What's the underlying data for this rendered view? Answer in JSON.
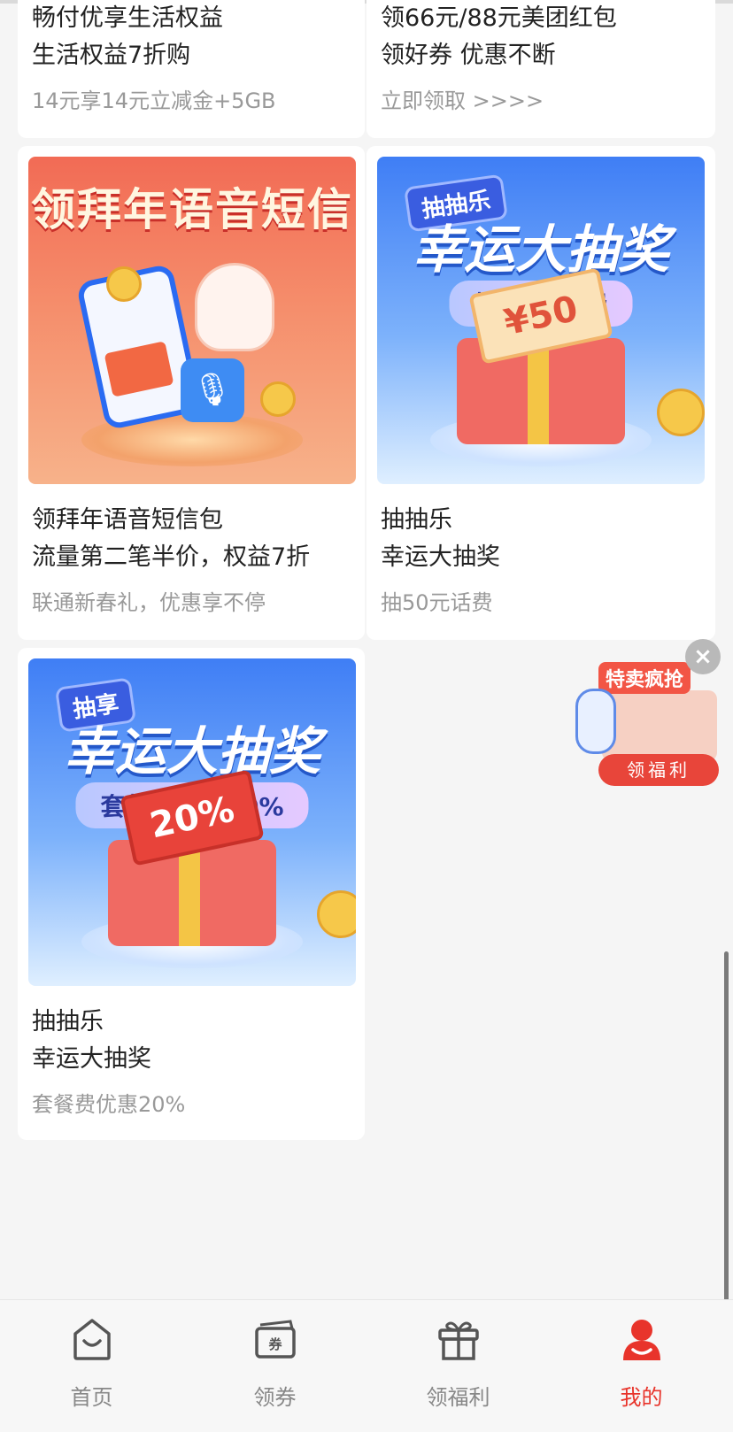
{
  "cards": [
    {
      "title1": "畅付优享生活权益",
      "title2": "生活权益7折购",
      "sub": "14元享14元立减金+5GB"
    },
    {
      "title1": "领66元/88元美团红包",
      "title2": "领好券 优惠不断",
      "sub": "立即领取 >>>>"
    },
    {
      "title1": "领拜年语音短信包",
      "title2": "流量第二笔半价，权益7折",
      "sub": "联通新春礼，优惠享不停",
      "banner": {
        "headline": "领拜年语音短信"
      }
    },
    {
      "title1": "抽抽乐",
      "title2": "幸运大抽奖",
      "sub": "抽50元话费",
      "banner": {
        "tag": "抽抽乐",
        "headline": "幸运大抽奖",
        "pill": "抽50元话费",
        "ticket": "¥50"
      }
    },
    {
      "title1": "抽抽乐",
      "title2": "幸运大抽奖",
      "sub": "套餐费优惠20%",
      "banner": {
        "tag": "抽享",
        "headline": "幸运大抽奖",
        "pill": "套餐费优惠20%",
        "ticket": "20%"
      }
    }
  ],
  "float_ad": {
    "label": "特卖疯抢",
    "button": "领福利",
    "close": "×"
  },
  "tabbar": {
    "items": [
      {
        "label": "首页",
        "icon": "home-icon",
        "active": false
      },
      {
        "label": "领券",
        "icon": "coupon-icon",
        "active": false
      },
      {
        "label": "领福利",
        "icon": "gift-icon",
        "active": false
      },
      {
        "label": "我的",
        "icon": "user-icon",
        "active": true
      }
    ],
    "active_color": "#e8342b",
    "inactive_color": "#888888"
  }
}
